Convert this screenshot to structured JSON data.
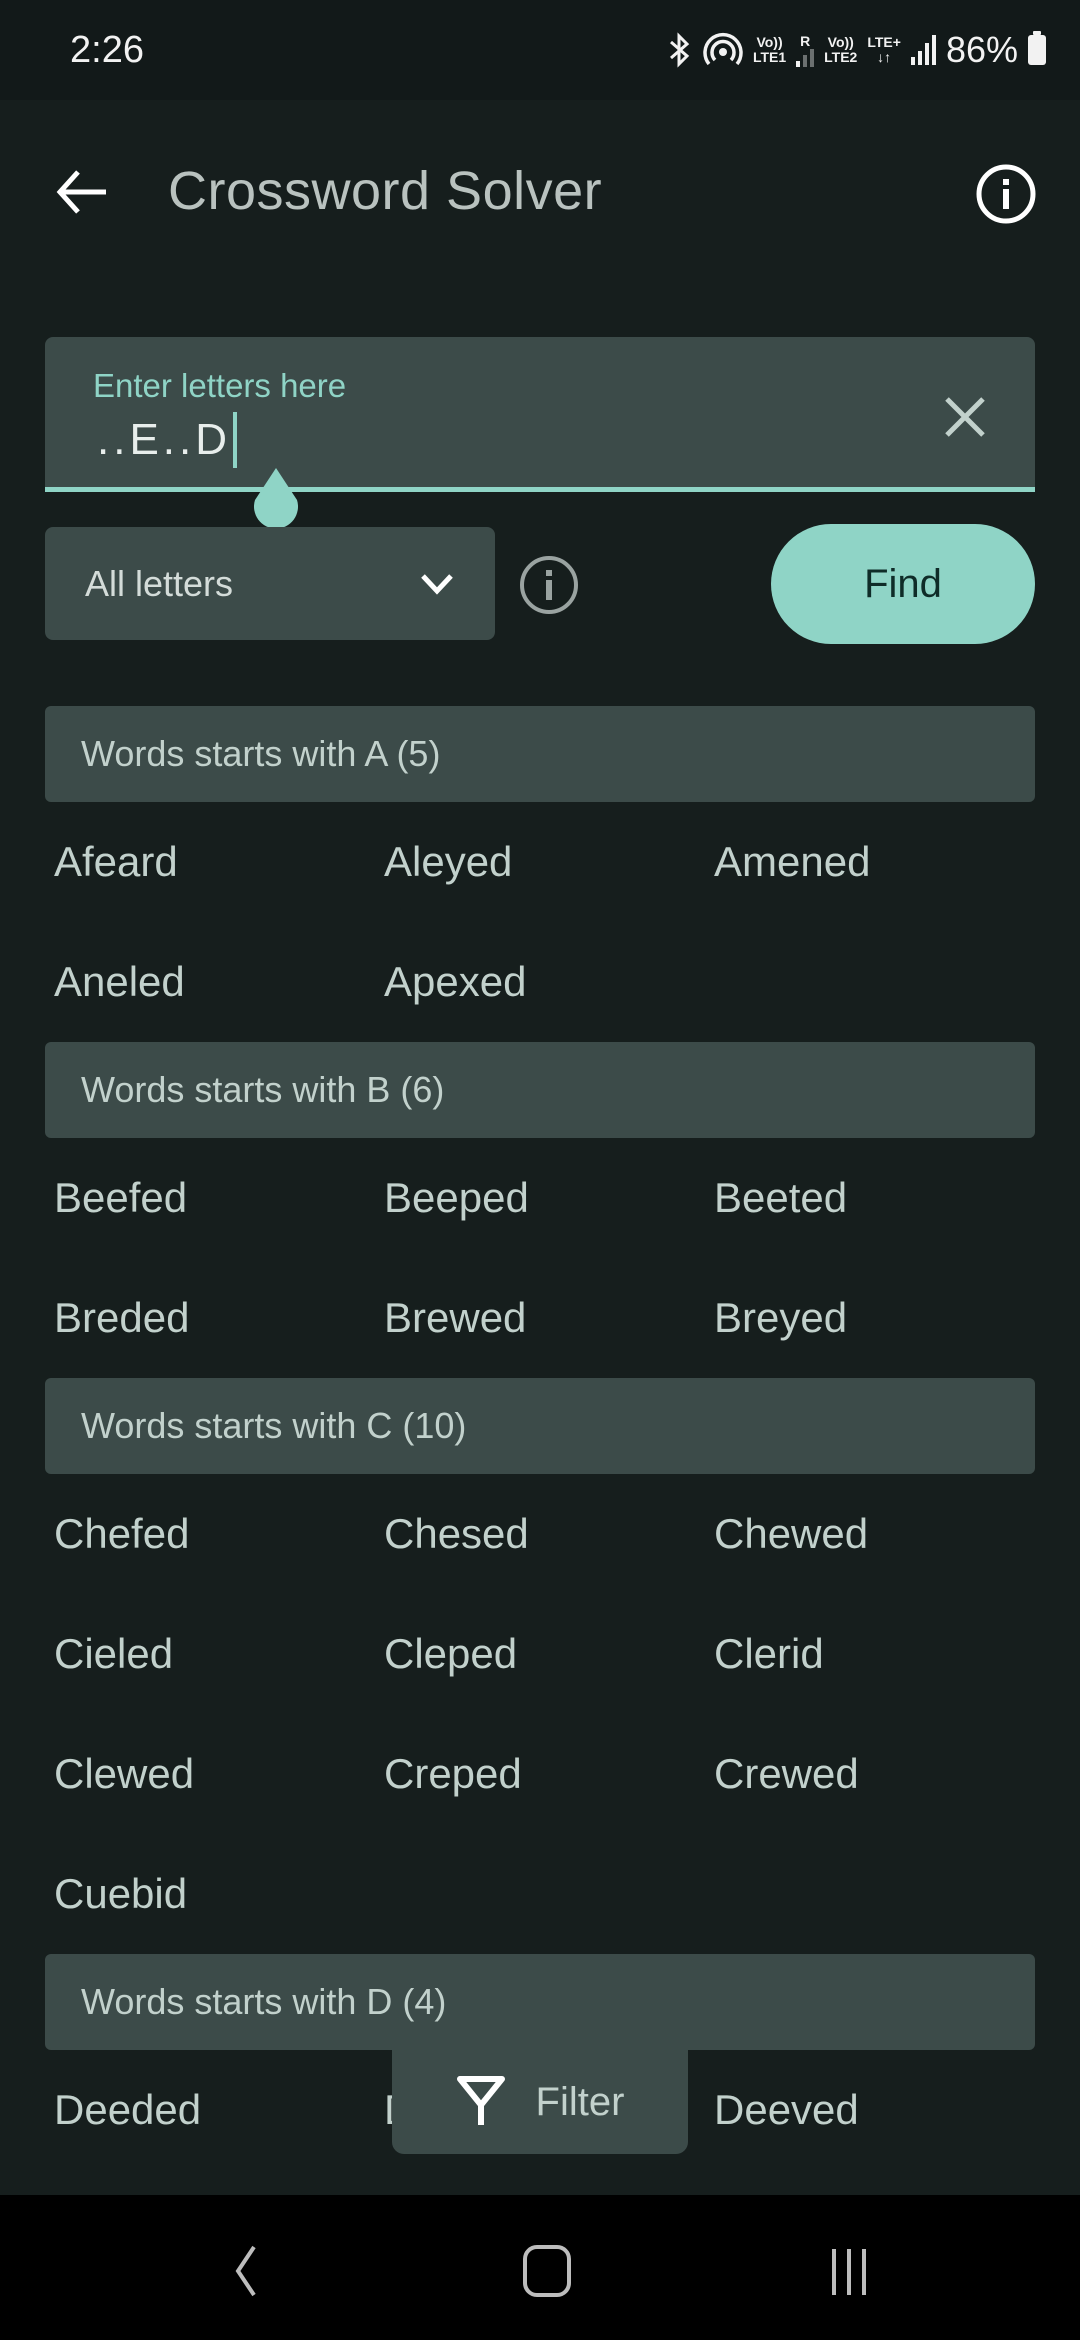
{
  "status_bar": {
    "time": "2:26",
    "battery_percent": "86%",
    "sim1_label_top": "Vo))",
    "sim1_label_bottom": "LTE1",
    "sim1_roaming": "R",
    "sim2_label_top": "Vo))",
    "sim2_label_bottom": "LTE2",
    "sim2_network": "LTE+",
    "icons": [
      "bluetooth-icon",
      "hotspot-icon",
      "signal-icon",
      "battery-charging-icon"
    ]
  },
  "app_bar": {
    "title": "Crossword Solver",
    "back_icon": "arrow-left-icon",
    "info_icon": "info-circle-icon"
  },
  "search": {
    "label": "Enter letters here",
    "value": "..E..D",
    "clear_icon": "close-icon"
  },
  "letter_filter": {
    "selected": "All letters",
    "chevron_icon": "chevron-down-icon"
  },
  "find_button": {
    "label": "Find"
  },
  "accent_color": "#8fd4c6",
  "groups": [
    {
      "header": "Words starts with A (5)",
      "words": [
        "Afeard",
        "Aleyed",
        "Amened",
        "Aneled",
        "Apexed"
      ]
    },
    {
      "header": "Words starts with B (6)",
      "words": [
        "Beefed",
        "Beeped",
        "Beeted",
        "Breded",
        "Brewed",
        "Breyed"
      ]
    },
    {
      "header": "Words starts with C (10)",
      "words": [
        "Chefed",
        "Chesed",
        "Chewed",
        "Cieled",
        "Cleped",
        "Clerid",
        "Clewed",
        "Creped",
        "Crewed",
        "Cuebid"
      ]
    },
    {
      "header": "Words starts with D (4)",
      "words": [
        "Deeded",
        "Deemed",
        "Deeved"
      ]
    }
  ],
  "filter_button": {
    "label": "Filter",
    "icon": "filter-icon"
  },
  "nav_bar": {
    "back": "nav-back-icon",
    "home": "nav-home-icon",
    "recents": "nav-recents-icon"
  }
}
